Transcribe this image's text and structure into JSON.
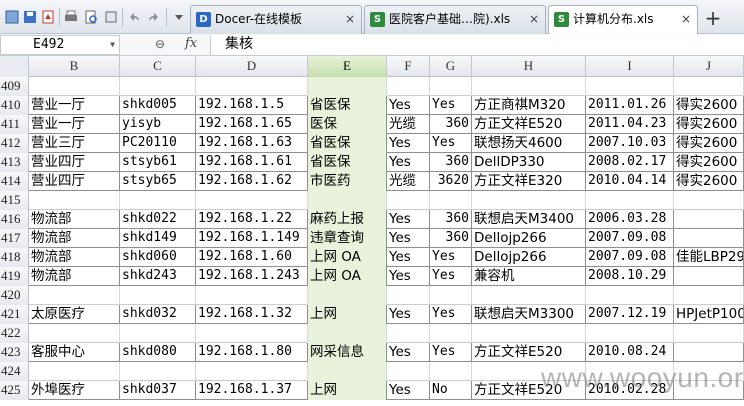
{
  "tabs": [
    {
      "label": "Docer-在线模板",
      "icon": "D",
      "color": "#2b67c6",
      "active": false
    },
    {
      "label": "医院客户基础…院).xls",
      "icon": "S",
      "color": "#2e8b3c",
      "active": false
    },
    {
      "label": "计算机分布.xls",
      "icon": "S",
      "color": "#2e8b3c",
      "active": true
    }
  ],
  "tab_close": "×",
  "tab_add": "+",
  "formula_bar": {
    "cell_ref": "E492",
    "fx": "fx",
    "zoom_symbol": "⊖",
    "content": "集核"
  },
  "columns": [
    "B",
    "C",
    "D",
    "E",
    "F",
    "G",
    "H",
    "I",
    "J"
  ],
  "selected_column": "E",
  "rows": [
    {
      "n": "409",
      "cells": []
    },
    {
      "n": "410",
      "cells": [
        "营业一厅",
        "shkd005",
        "192.168.1.5",
        "省医保",
        "Yes",
        "Yes",
        "方正商祺M320",
        "2011.01.26",
        "得实2600"
      ]
    },
    {
      "n": "411",
      "cells": [
        "营业一厅",
        "yisyb",
        "192.168.1.65",
        "医保",
        "光缆",
        "360",
        "方正文祥E520",
        "2011.04.23",
        "得实2600"
      ]
    },
    {
      "n": "412",
      "cells": [
        "营业三厅",
        "PC20110",
        "192.168.1.63",
        "省医保",
        "Yes",
        "Yes",
        "联想扬天4600",
        "2007.10.03",
        "得实2600"
      ]
    },
    {
      "n": "413",
      "cells": [
        "营业四厅",
        "stsyb61",
        "192.168.1.61",
        "省医保",
        "Yes",
        "360",
        "DellDP330",
        "2008.02.17",
        "得实2600"
      ]
    },
    {
      "n": "414",
      "cells": [
        "营业四厅",
        "stsyb65",
        "192.168.1.62",
        "市医药",
        "光缆",
        "3620",
        "方正文祥E320",
        "2010.04.14",
        "得实2600"
      ]
    },
    {
      "n": "415",
      "cells": []
    },
    {
      "n": "416",
      "cells": [
        "物流部",
        "shkd022",
        "192.168.1.22",
        "麻药上报",
        "Yes",
        "360",
        "联想启天M3400",
        "2006.03.28",
        ""
      ]
    },
    {
      "n": "417",
      "cells": [
        "物流部",
        "shkd149",
        "192.168.1.149",
        "违章查询",
        "Yes",
        "360",
        "Dellojp266",
        "2007.09.08",
        ""
      ]
    },
    {
      "n": "418",
      "cells": [
        "物流部",
        "shkd060",
        "192.168.1.60",
        "上网 OA",
        "Yes",
        "Yes",
        "Dellojp266",
        "2007.09.08",
        "佳能LBP29"
      ]
    },
    {
      "n": "419",
      "cells": [
        "物流部",
        "shkd243",
        "192.168.1.243",
        "上网 OA",
        "Yes",
        "Yes",
        "兼容机",
        "2008.10.29",
        ""
      ]
    },
    {
      "n": "420",
      "cells": []
    },
    {
      "n": "421",
      "cells": [
        "太原医疗",
        "shkd032",
        "192.168.1.32",
        "上网",
        "Yes",
        "Yes",
        "联想启天M3300",
        "2007.12.19",
        "HPJetP100"
      ]
    },
    {
      "n": "422",
      "cells": []
    },
    {
      "n": "423",
      "cells": [
        "客服中心",
        "shkd080",
        "192.168.1.80",
        "网采信息",
        "Yes",
        "Yes",
        "方正文祥E520",
        "2010.08.24",
        ""
      ]
    },
    {
      "n": "424",
      "cells": []
    },
    {
      "n": "425",
      "cells": [
        "外埠医疗",
        "shkd037",
        "192.168.1.37",
        "上网",
        "Yes",
        "No",
        "方正文祥E520",
        "2010.02.28",
        ""
      ]
    }
  ],
  "watermark": "www.wooyun.org",
  "colors": {
    "selected_header": "#c8dfad",
    "accent_blue": "#2b67c6",
    "sheet_green": "#2e8b3c"
  }
}
